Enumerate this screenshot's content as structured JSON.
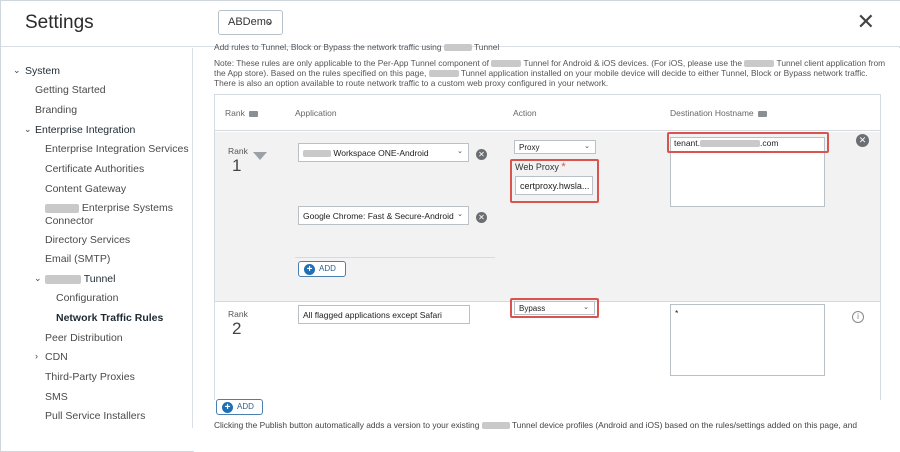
{
  "header": {
    "title": "Settings",
    "org_selector": "ABDemo",
    "close_label": "✕"
  },
  "sidebar": {
    "system": "System",
    "getting_started": "Getting Started",
    "branding": "Branding",
    "enterprise_integration": "Enterprise Integration",
    "enterprise_integration_services": "Enterprise Integration Services",
    "certificate_authorities": "Certificate Authorities",
    "content_gateway": "Content Gateway",
    "enterprise_systems_connector_a": "Enterprise Systems",
    "enterprise_systems_connector_b": "Connector",
    "directory_services": "Directory Services",
    "email_smtp": "Email (SMTP)",
    "tunnel": "Tunnel",
    "configuration": "Configuration",
    "network_traffic_rules": "Network Traffic Rules",
    "peer_distribution": "Peer Distribution",
    "cdn": "CDN",
    "third_party_proxies": "Third-Party Proxies",
    "sms": "SMS",
    "pull_service_installers": "Pull Service Installers"
  },
  "content": {
    "intro_a": "Add rules to Tunnel, Block or Bypass the network traffic using",
    "intro_b": "Tunnel",
    "note_line1_a": "Note: These rules are only applicable to the Per-App Tunnel component of",
    "note_line1_b": "Tunnel for Android & iOS devices. (For iOS, please use the",
    "note_line1_c": "Tunnel client application from",
    "note_line2_a": "the App store). Based on the rules specified on this page,",
    "note_line2_b": "Tunnel application installed on your mobile device will decide to either Tunnel, Block or Bypass network traffic.",
    "note_line3": "There is also an option available to route network traffic to a custom web proxy configured in your network.",
    "columns": {
      "rank": "Rank",
      "application": "Application",
      "action": "Action",
      "destination": "Destination Hostname"
    },
    "rule1": {
      "rank_label": "Rank",
      "rank_value": "1",
      "app1": "Workspace ONE-Android",
      "app2": "Google Chrome: Fast & Secure-Android",
      "action": "Proxy",
      "web_proxy_label": "Web Proxy",
      "web_proxy_required": "*",
      "web_proxy_value": "certproxy.hwsla...",
      "destination_a": "tenant.",
      "destination_b": ".com",
      "add_label": "ADD"
    },
    "rule2": {
      "rank_label": "Rank",
      "rank_value": "2",
      "app": "All flagged applications except Safari",
      "action": "Bypass",
      "destination": "*"
    },
    "add_rule_label": "ADD",
    "footer_a": "Clicking the Publish button automatically adds a version to your existing",
    "footer_b": "Tunnel device profiles (Android and iOS) based on the rules/settings added on this page, and"
  },
  "colors": {
    "highlight": "#d9534f",
    "accent": "#1f6fb5"
  }
}
